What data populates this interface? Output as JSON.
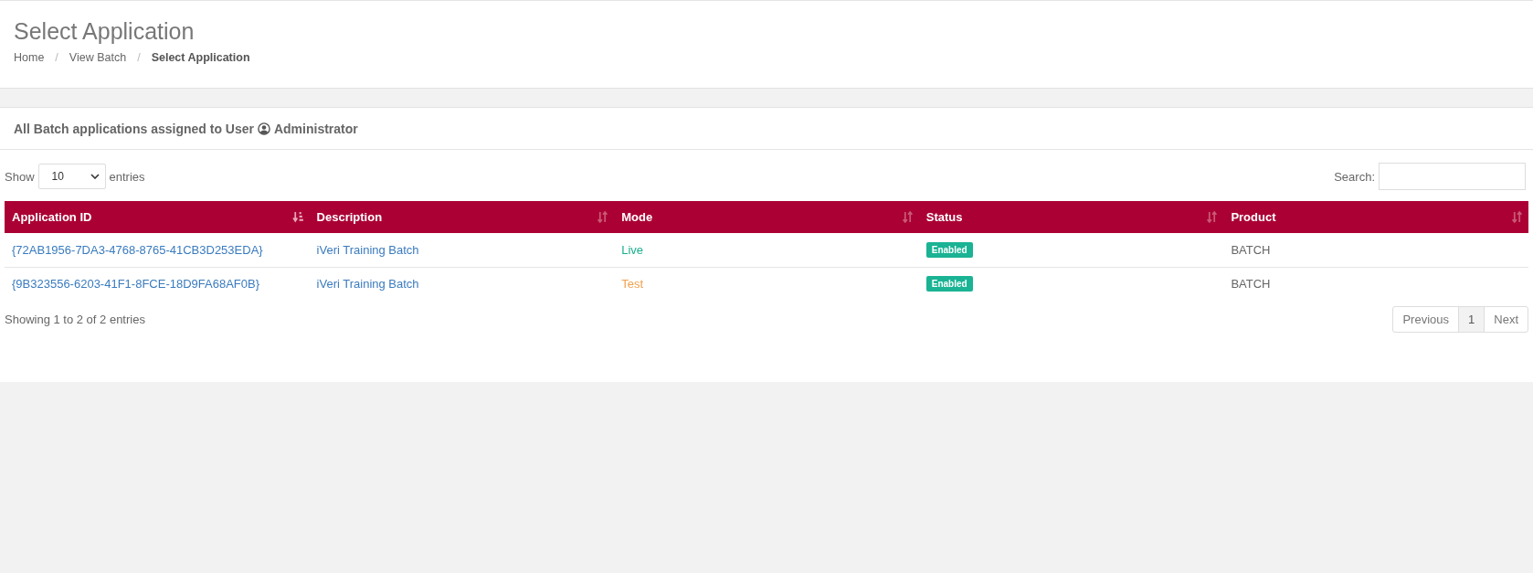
{
  "page_title": "Select Application",
  "breadcrumb": [
    {
      "label": "Home",
      "current": false
    },
    {
      "separator": "/",
      "label": "View Batch",
      "current": false
    },
    {
      "separator": "/",
      "label": "Select Application",
      "current": true
    }
  ],
  "panel": {
    "title": "All Batch applications assigned to User",
    "user": "Administrator"
  },
  "length_menu": {
    "before": "Show",
    "value": "10",
    "after": "entries"
  },
  "search": {
    "label": "Search:"
  },
  "table": {
    "columns": [
      {
        "label": "Application ID",
        "sorted": true
      },
      {
        "label": "Description",
        "sorted": false
      },
      {
        "label": "Mode",
        "sorted": false
      },
      {
        "label": "Status",
        "sorted": false
      },
      {
        "label": "Product",
        "sorted": false
      }
    ],
    "rows": [
      {
        "id": "{72AB1956-7DA3-4768-8765-41CB3D253EDA}",
        "description": "iVeri Training Batch",
        "mode": {
          "label": "Live",
          "kind": "live"
        },
        "status": "Enabled",
        "product": "BATCH"
      },
      {
        "id": "{9B323556-6203-41F1-8FCE-18D9FA68AF0B}",
        "description": "iVeri Training Batch",
        "mode": {
          "label": "Test",
          "kind": "test"
        },
        "status": "Enabled",
        "product": "BATCH"
      }
    ]
  },
  "info": "Showing 1 to 2 of 2 entries",
  "pagination": [
    {
      "label": "Previous",
      "selected": false
    },
    {
      "label": "1",
      "selected": true
    },
    {
      "label": "Next",
      "selected": false
    }
  ]
}
